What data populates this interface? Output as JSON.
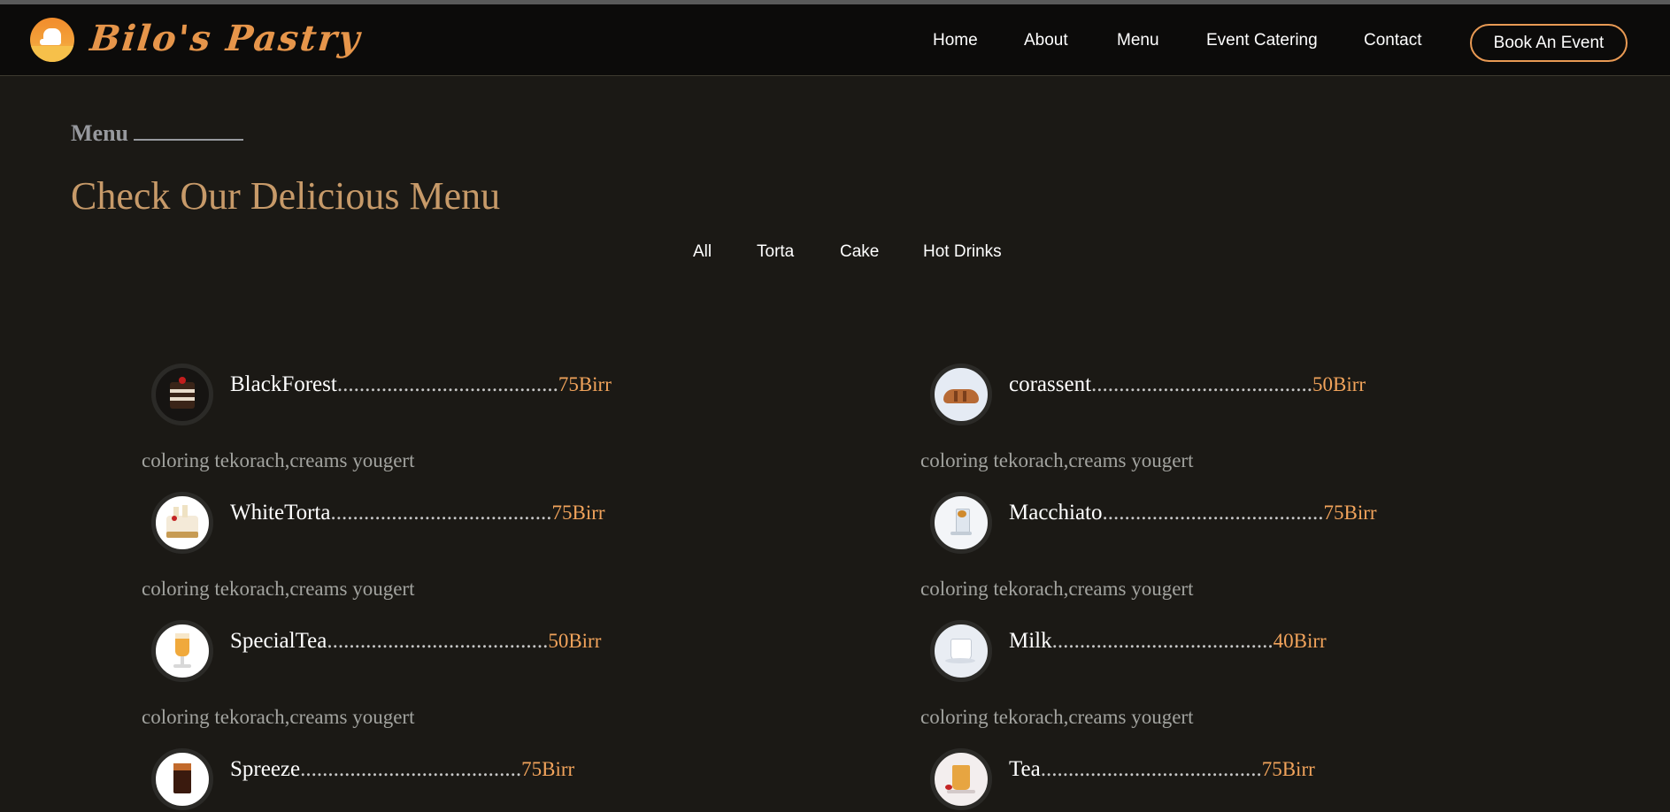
{
  "brand": {
    "name": "Bilo's Pastry",
    "logo_icon": "chef-hat-icon"
  },
  "nav": {
    "home": "Home",
    "about": "About",
    "menu": "Menu",
    "event_catering": "Event Catering",
    "contact": "Contact",
    "book_button": "Book An Event"
  },
  "section": {
    "label": "Menu",
    "title": "Check Our Delicious Menu"
  },
  "filters": [
    "All",
    "Torta",
    "Cake",
    "Hot Drinks"
  ],
  "items": [
    {
      "name": "BlackForest",
      "dots": "........................................",
      "price": "75Birr",
      "desc": "coloring tekorach,creams yougert",
      "image": "black-forest-cake-image"
    },
    {
      "name": "corassent",
      "dots": "........................................",
      "price": "50Birr",
      "desc": "coloring tekorach,creams yougert",
      "image": "croissant-image"
    },
    {
      "name": "WhiteTorta",
      "dots": "........................................",
      "price": "75Birr",
      "desc": "coloring tekorach,creams yougert",
      "image": "white-torta-image"
    },
    {
      "name": "Macchiato",
      "dots": "........................................",
      "price": "75Birr",
      "desc": "coloring tekorach,creams yougert",
      "image": "macchiato-image"
    },
    {
      "name": "SpecialTea",
      "dots": "........................................",
      "price": "50Birr",
      "desc": "coloring tekorach,creams yougert",
      "image": "special-tea-image"
    },
    {
      "name": "Milk",
      "dots": "........................................",
      "price": "40Birr",
      "desc": "coloring tekorach,creams yougert",
      "image": "milk-cup-image"
    },
    {
      "name": "Spreeze",
      "dots": "........................................",
      "price": "75Birr",
      "desc": "",
      "image": "spreeze-drink-image"
    },
    {
      "name": "Tea",
      "dots": "........................................",
      "price": "75Birr",
      "desc": "",
      "image": "tea-glass-image"
    }
  ],
  "colors": {
    "background": "#1b1915",
    "header": "#0c0b0a",
    "accent": "#e99a54",
    "title": "#c79a69",
    "price": "#f1a35b"
  }
}
